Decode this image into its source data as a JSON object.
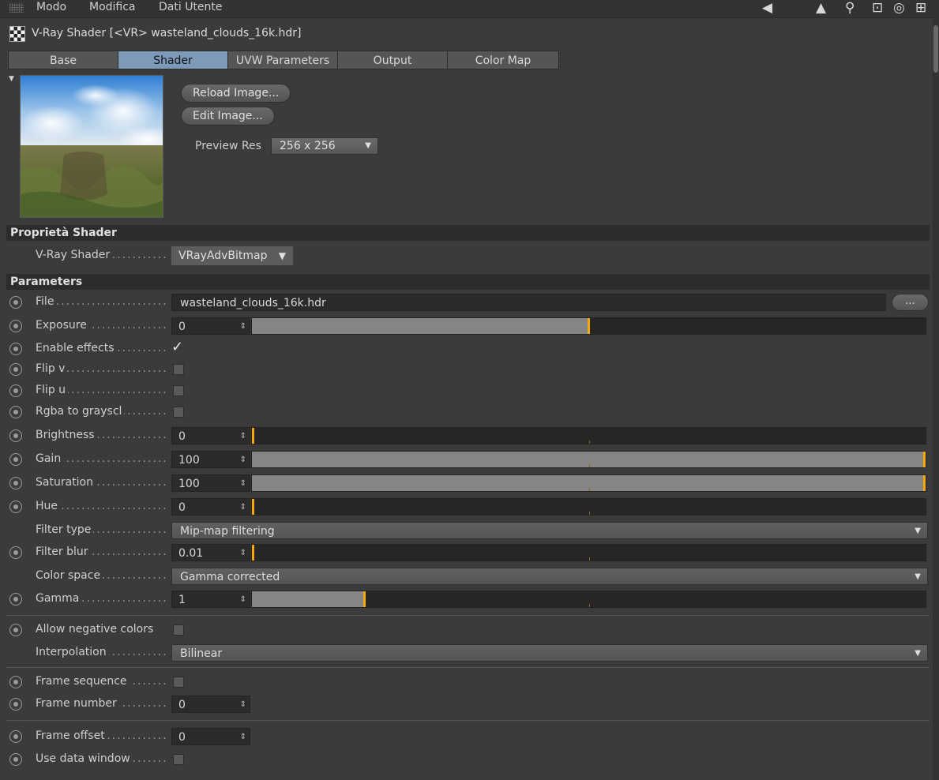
{
  "menubar": {
    "items": [
      "Modo",
      "Modifica",
      "Dati Utente"
    ]
  },
  "title": "V-Ray Shader [<VR> wasteland_clouds_16k.hdr]",
  "tabs": [
    {
      "label": "Base",
      "active": false
    },
    {
      "label": "Shader",
      "active": true
    },
    {
      "label": "UVW Parameters",
      "active": false
    },
    {
      "label": "Output",
      "active": false
    },
    {
      "label": "Color Map",
      "active": false
    }
  ],
  "preview": {
    "reload_label": "Reload Image...",
    "edit_label": "Edit Image...",
    "res_label": "Preview Res",
    "res_value": "256 x 256"
  },
  "shader_props": {
    "header": "Proprietà Shader",
    "shader_label": "V-Ray Shader",
    "shader_value": "VRayAdvBitmap"
  },
  "parameters": {
    "header": "Parameters",
    "file": {
      "label": "File",
      "value": "wasteland_clouds_16k.hdr",
      "browse": "..."
    },
    "exposure": {
      "label": "Exposure",
      "value": "0",
      "slider": 0.5
    },
    "enable_effects": {
      "label": "Enable effects",
      "checked": true
    },
    "flip_v": {
      "label": "Flip v",
      "checked": false
    },
    "flip_u": {
      "label": "Flip u",
      "checked": false
    },
    "rgba_gray": {
      "label": "Rgba to grayscl",
      "checked": false
    },
    "brightness": {
      "label": "Brightness",
      "value": "0",
      "slider": 0.0
    },
    "gain": {
      "label": "Gain",
      "value": "100",
      "slider": 1.0
    },
    "saturation": {
      "label": "Saturation",
      "value": "100",
      "slider": 1.0
    },
    "hue": {
      "label": "Hue",
      "value": "0",
      "slider": 0.0
    },
    "filter_type": {
      "label": "Filter type",
      "value": "Mip-map filtering"
    },
    "filter_blur": {
      "label": "Filter blur",
      "value": "0.01",
      "slider": 0.0
    },
    "color_space": {
      "label": "Color space",
      "value": "Gamma corrected"
    },
    "gamma": {
      "label": "Gamma",
      "value": "1",
      "slider": 0.166
    },
    "allow_negative": {
      "label": "Allow negative colors",
      "checked": false
    },
    "interpolation": {
      "label": "Interpolation",
      "value": "Bilinear"
    },
    "frame_sequence": {
      "label": "Frame sequence",
      "checked": false
    },
    "frame_number": {
      "label": "Frame number",
      "value": "0"
    },
    "frame_offset": {
      "label": "Frame offset",
      "value": "0"
    },
    "use_data_window": {
      "label": "Use data window",
      "checked": false
    }
  },
  "colors": {
    "accent": "#f5a800",
    "tab_active": "#7e9ab9",
    "background": "#3b3b3b"
  }
}
